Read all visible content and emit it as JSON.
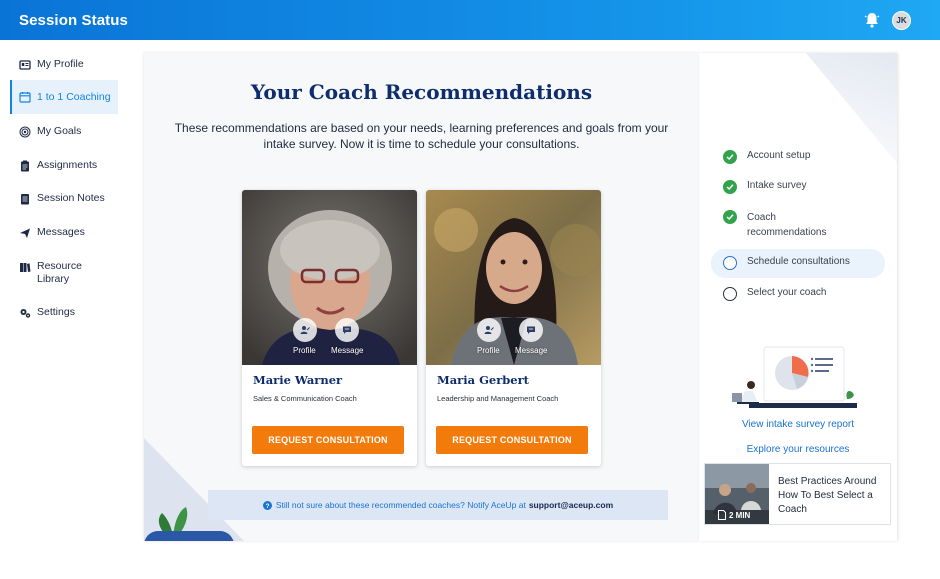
{
  "header": {
    "title": "Session Status",
    "avatar_initials": "JK",
    "brand_color": "#0a74d6"
  },
  "sidebar": {
    "items": [
      {
        "label": "My Profile",
        "icon": "id-card-icon"
      },
      {
        "label": "1 to 1 Coaching",
        "icon": "calendar-icon",
        "active": true
      },
      {
        "label": "My Goals",
        "icon": "target-icon"
      },
      {
        "label": "Assignments",
        "icon": "clipboard-icon"
      },
      {
        "label": "Session Notes",
        "icon": "notes-icon"
      },
      {
        "label": "Messages",
        "icon": "paper-plane-icon"
      },
      {
        "label": "Resource Library",
        "icon": "books-icon"
      },
      {
        "label": "Settings",
        "icon": "gears-icon"
      }
    ]
  },
  "main": {
    "heading": "Your Coach Recommendations",
    "subtext": "These recommendations are based on your needs, learning preferences and goals from your intake survey. Now it is time to schedule your consultations.",
    "coaches": [
      {
        "name": "Marie Warner",
        "role": "Sales & Communication Coach",
        "profile_label": "Profile",
        "message_label": "Message",
        "button": "REQUEST CONSULTATION"
      },
      {
        "name": "Maria Gerbert",
        "role": "Leadership and Management Coach",
        "profile_label": "Profile",
        "message_label": "Message",
        "button": "REQUEST CONSULTATION"
      }
    ],
    "notice_text": "Still not sure about these recommended coaches? Notify AceUp at",
    "notice_email": "support@aceup.com",
    "accent_color": "#f27b0c"
  },
  "progress": {
    "steps": [
      {
        "label": "Account setup",
        "status": "done"
      },
      {
        "label": "Intake survey",
        "status": "done"
      },
      {
        "label": "Coach recommendations",
        "status": "done"
      },
      {
        "label": "Schedule consultations",
        "status": "current"
      },
      {
        "label": "Select your coach",
        "status": "todo"
      }
    ],
    "link_report": "View intake survey report",
    "link_resources": "Explore your resources",
    "video": {
      "title": "Best Practices Around How To Best Select a Coach",
      "duration": "2 MIN"
    }
  }
}
